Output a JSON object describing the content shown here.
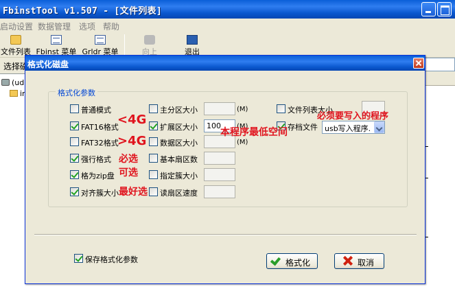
{
  "window": {
    "title": "FbinstTool v1.507 - [文件列表]"
  },
  "menubar": {
    "items": [
      "启动设置",
      "数据管理",
      "选项",
      "帮助"
    ]
  },
  "toolbar": {
    "file_list": "文件列表",
    "fbinst_menu": "Fbinst 菜单",
    "grldr_menu": "Grldr 菜单",
    "up": "向上",
    "exit": "退出"
  },
  "background": {
    "select_disk_label": "选择磁盘",
    "tree": [
      "(ud)/",
      "img"
    ]
  },
  "dialog": {
    "title": "格式化磁盘",
    "group_title": "格式化参数",
    "options_left": [
      {
        "label": "普通模式",
        "checked": false
      },
      {
        "label": "FAT16格式",
        "checked": true
      },
      {
        "label": "FAT32格式",
        "checked": false
      },
      {
        "label": "强行格式",
        "checked": true
      },
      {
        "label": "格为zip盘",
        "checked": true
      },
      {
        "label": "对齐簇大小",
        "checked": true
      }
    ],
    "options_mid": [
      {
        "label": "主分区大小",
        "checked": false,
        "value": "",
        "unit": "(M)"
      },
      {
        "label": "扩展区大小",
        "checked": true,
        "value": "100",
        "unit": "(M)"
      },
      {
        "label": "数据区大小",
        "checked": false,
        "value": "",
        "unit": "(M)"
      },
      {
        "label": "基本扇区数",
        "checked": false,
        "value": "",
        "unit": ""
      },
      {
        "label": "指定簇大小",
        "checked": false,
        "value": "",
        "unit": ""
      },
      {
        "label": "读扇区速度",
        "checked": false,
        "value": "",
        "unit": ""
      }
    ],
    "file_list_size": {
      "label": "文件列表大小",
      "checked": false,
      "value": ""
    },
    "archive_file": {
      "label": "存档文件",
      "checked": true,
      "selected": "usb写入程序."
    },
    "save_params": {
      "label": "保存格式化参数",
      "checked": true
    },
    "ok_label": "格式化",
    "cancel_label": "取消"
  },
  "annotations": {
    "fat16": "<4G",
    "fat32": ">4G",
    "must_select": "必选",
    "optional": "可选",
    "recommended": "最好选",
    "min_space": "本程序最低空间",
    "must_write": "必须要写入的程序"
  },
  "colors": {
    "annotation": "#e0141e",
    "titlebar": "#0a5fd8",
    "group_title": "#0046d5"
  }
}
